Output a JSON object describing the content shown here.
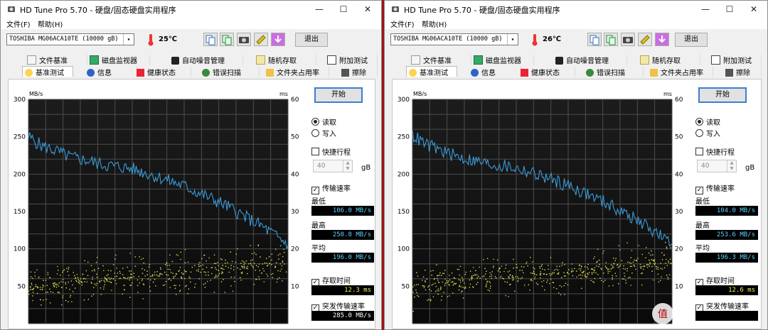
{
  "colors": {
    "transfer_line": "#3a9bd8",
    "access_dots": "#dcdc50",
    "grid": "#4d4d4d",
    "chart_bg_top": "#1b1b1b",
    "lcd_text": "#5bd3ff"
  },
  "windows": [
    {
      "title": "HD Tune Pro 5.70 - 硬盘/固态硬盘实用程序",
      "menu": {
        "file": "文件(F)",
        "help": "帮助(H)"
      },
      "drive": "TOSHIBA MG06ACA10TE (10000 gB)",
      "temp": "25℃",
      "exit_label": "退出",
      "tabs_top": [
        "文件基准",
        "磁盘监视器",
        "自动噪音管理",
        "随机存取",
        "附加测试"
      ],
      "tabs_bottom": [
        "基准测试",
        "信息",
        "健康状态",
        "错误扫描",
        "文件夹占用率",
        "擦除"
      ],
      "start_label": "开始",
      "read_label": "读取",
      "write_label": "写入",
      "short_stroke_label": "快捷行程",
      "short_stroke_value": "40",
      "short_stroke_unit": "gB",
      "transfer_rate_label": "传输速率",
      "min_label": "最低",
      "min_value": "106.0 MB/s",
      "max_label": "最高",
      "max_value": "250.8 MB/s",
      "avg_label": "平均",
      "avg_value": "196.0 MB/s",
      "access_time_label": "存取时间",
      "access_time_value": "12.3 ms",
      "burst_label": "突发传输速率",
      "burst_value": "285.0 MB/s",
      "chart_data": {
        "type": "line",
        "y_left_unit": "MB/s",
        "y_right_unit": "ms",
        "y_left_ticks": [
          "300",
          "250",
          "200",
          "150",
          "100",
          "50"
        ],
        "y_right_ticks": [
          "60",
          "50",
          "40",
          "30",
          "20",
          "10"
        ],
        "ylim_left": [
          0,
          300
        ],
        "ylim_right": [
          0,
          60
        ],
        "grid": true,
        "x": [
          0,
          5,
          10,
          15,
          20,
          25,
          30,
          35,
          40,
          45,
          50,
          55,
          60,
          65,
          70,
          75,
          80,
          85,
          90,
          95,
          100
        ],
        "series": [
          {
            "values": [
              250,
              238,
              232,
              224,
              220,
              216,
              212,
              210,
              207,
              202,
              196,
              190,
              184,
              176,
              168,
              160,
              150,
              140,
              130,
              118,
              106
            ]
          },
          {
            "values": [
              9.5,
              10,
              10.5,
              11,
              11.3,
              11.6,
              12,
              12.2,
              12.5,
              12.8,
              13,
              13.3,
              13.6,
              14,
              14.3,
              14.6,
              15,
              15.3,
              15.6,
              16,
              16.3
            ]
          }
        ]
      }
    },
    {
      "title": "HD Tune Pro 5.70 - 硬盘/固态硬盘实用程序",
      "menu": {
        "file": "文件(F)",
        "help": "帮助(H)"
      },
      "drive": "TOSHIBA MG06ACA10TE (10000 gB)",
      "temp": "26℃",
      "exit_label": "退出",
      "tabs_top": [
        "文件基准",
        "磁盘监视器",
        "自动噪音管理",
        "随机存取",
        "附加测试"
      ],
      "tabs_bottom": [
        "基准测试",
        "信息",
        "健康状态",
        "错误扫描",
        "文件夹占用率",
        "擦除"
      ],
      "start_label": "开始",
      "read_label": "读取",
      "write_label": "写入",
      "short_stroke_label": "快捷行程",
      "short_stroke_value": "40",
      "short_stroke_unit": "gB",
      "transfer_rate_label": "传输速率",
      "min_label": "最低",
      "min_value": "104.0 MB/s",
      "max_label": "最高",
      "max_value": "253.6 MB/s",
      "avg_label": "平均",
      "avg_value": "196.3 MB/s",
      "access_time_label": "存取时间",
      "access_time_value": "12.6 ms",
      "burst_label": "突发传输速率",
      "burst_value": "",
      "chart_data": {
        "type": "line",
        "y_left_unit": "MB/s",
        "y_right_unit": "ms",
        "y_left_ticks": [
          "300",
          "250",
          "200",
          "150",
          "100",
          "50"
        ],
        "y_right_ticks": [
          "60",
          "50",
          "40",
          "30",
          "20",
          "10"
        ],
        "ylim_left": [
          0,
          300
        ],
        "ylim_right": [
          0,
          60
        ],
        "grid": true,
        "x": [
          0,
          5,
          10,
          15,
          20,
          25,
          30,
          35,
          40,
          45,
          50,
          55,
          60,
          65,
          70,
          75,
          80,
          85,
          90,
          95,
          100
        ],
        "series": [
          {
            "values": [
              252,
              240,
              233,
              226,
              221,
              217,
              213,
              211,
              208,
              203,
              197,
              191,
              185,
              177,
              169,
              161,
              151,
              141,
              131,
              119,
              104
            ]
          },
          {
            "values": [
              9.6,
              10.1,
              10.6,
              11.1,
              11.4,
              11.7,
              12.1,
              12.3,
              12.6,
              12.9,
              13.1,
              13.4,
              13.7,
              14.1,
              14.4,
              14.7,
              15.1,
              15.4,
              15.7,
              16.1,
              16.4
            ]
          }
        ]
      }
    }
  ]
}
